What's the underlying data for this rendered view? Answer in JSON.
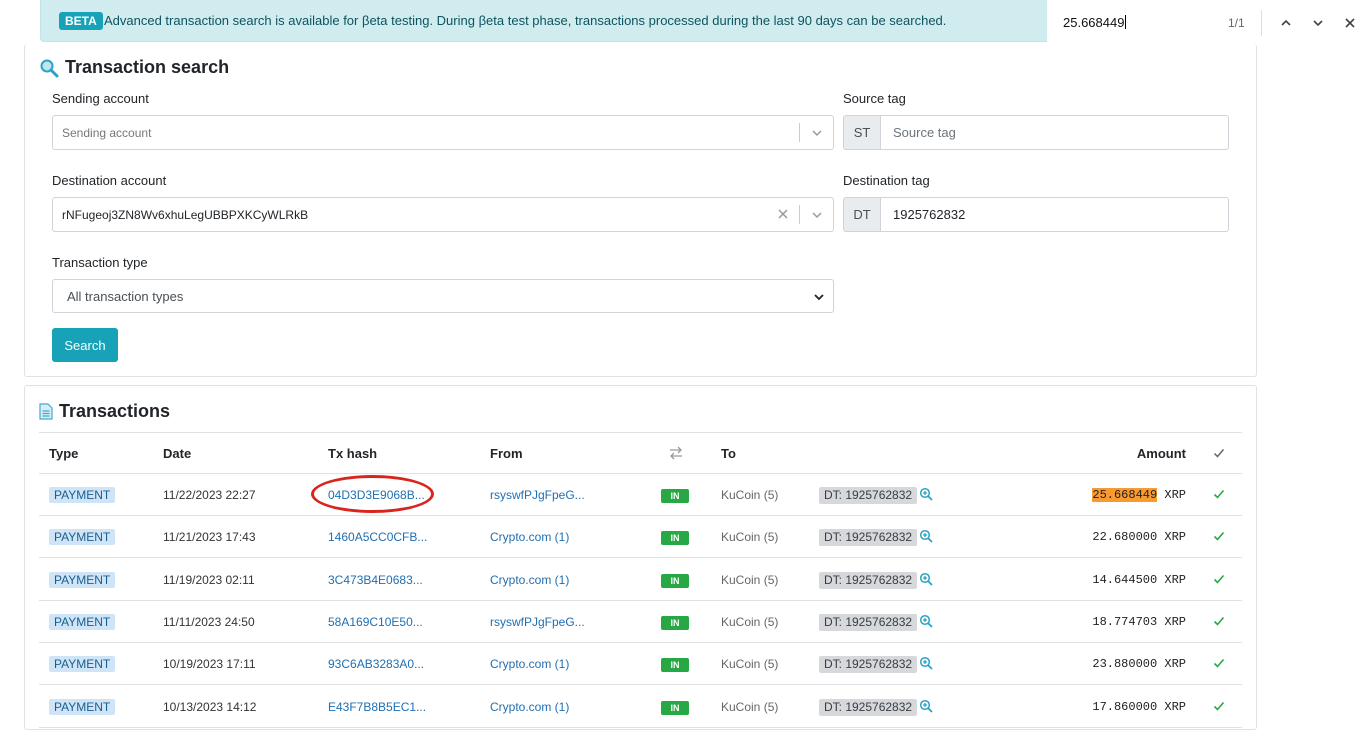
{
  "banner": {
    "badge": "BETA",
    "message": "Advanced transaction search is available for βeta testing. During βeta test phase, transactions processed during the last 90 days can be searched."
  },
  "find_bar": {
    "query": "25.668449",
    "count": "1/1"
  },
  "search": {
    "title": "Transaction search",
    "sending_account": {
      "label": "Sending account",
      "placeholder": "Sending account"
    },
    "source_tag": {
      "label": "Source tag",
      "addon": "ST",
      "placeholder": "Source tag"
    },
    "destination_account": {
      "label": "Destination account",
      "value": "rNFugeoj3ZN8Wv6xhuLegUBBPXKCyWLRkB"
    },
    "destination_tag": {
      "label": "Destination tag",
      "addon": "DT",
      "value": "1925762832"
    },
    "transaction_type": {
      "label": "Transaction type",
      "value": "All transaction types"
    },
    "search_button": "Search"
  },
  "transactions": {
    "title": "Transactions",
    "headers": {
      "type": "Type",
      "date": "Date",
      "hash": "Tx hash",
      "from": "From",
      "to": "To",
      "amount": "Amount"
    },
    "rows": [
      {
        "type": "PAYMENT",
        "date": "11/22/2023 22:27",
        "hash": "04D3D3E9068B...",
        "from": "rsyswfPJgFpeG...",
        "direction": "IN",
        "to": "KuCoin (5)",
        "dt": "DT: 1925762832",
        "amount": "25.668449",
        "currency": "XRP",
        "highlight": true
      },
      {
        "type": "PAYMENT",
        "date": "11/21/2023 17:43",
        "hash": "1460A5CC0CFB...",
        "from": "Crypto.com (1)",
        "direction": "IN",
        "to": "KuCoin (5)",
        "dt": "DT: 1925762832",
        "amount": "22.680000",
        "currency": "XRP",
        "highlight": false
      },
      {
        "type": "PAYMENT",
        "date": "11/19/2023 02:11",
        "hash": "3C473B4E0683...",
        "from": "Crypto.com (1)",
        "direction": "IN",
        "to": "KuCoin (5)",
        "dt": "DT: 1925762832",
        "amount": "14.644500",
        "currency": "XRP",
        "highlight": false
      },
      {
        "type": "PAYMENT",
        "date": "11/11/2023 24:50",
        "hash": "58A169C10E50...",
        "from": "rsyswfPJgFpeG...",
        "direction": "IN",
        "to": "KuCoin (5)",
        "dt": "DT: 1925762832",
        "amount": "18.774703",
        "currency": "XRP",
        "highlight": false
      },
      {
        "type": "PAYMENT",
        "date": "10/19/2023 17:11",
        "hash": "93C6AB3283A0...",
        "from": "Crypto.com (1)",
        "direction": "IN",
        "to": "KuCoin (5)",
        "dt": "DT: 1925762832",
        "amount": "23.880000",
        "currency": "XRP",
        "highlight": false
      },
      {
        "type": "PAYMENT",
        "date": "10/13/2023 14:12",
        "hash": "E43F7B8B5EC1...",
        "from": "Crypto.com (1)",
        "direction": "IN",
        "to": "KuCoin (5)",
        "dt": "DT: 1925762832",
        "amount": "17.860000",
        "currency": "XRP",
        "highlight": false
      }
    ]
  },
  "colors": {
    "accent": "#17a2b8",
    "in_badge": "#28a745",
    "highlight": "#f79a31",
    "annotation": "#d8261f"
  }
}
